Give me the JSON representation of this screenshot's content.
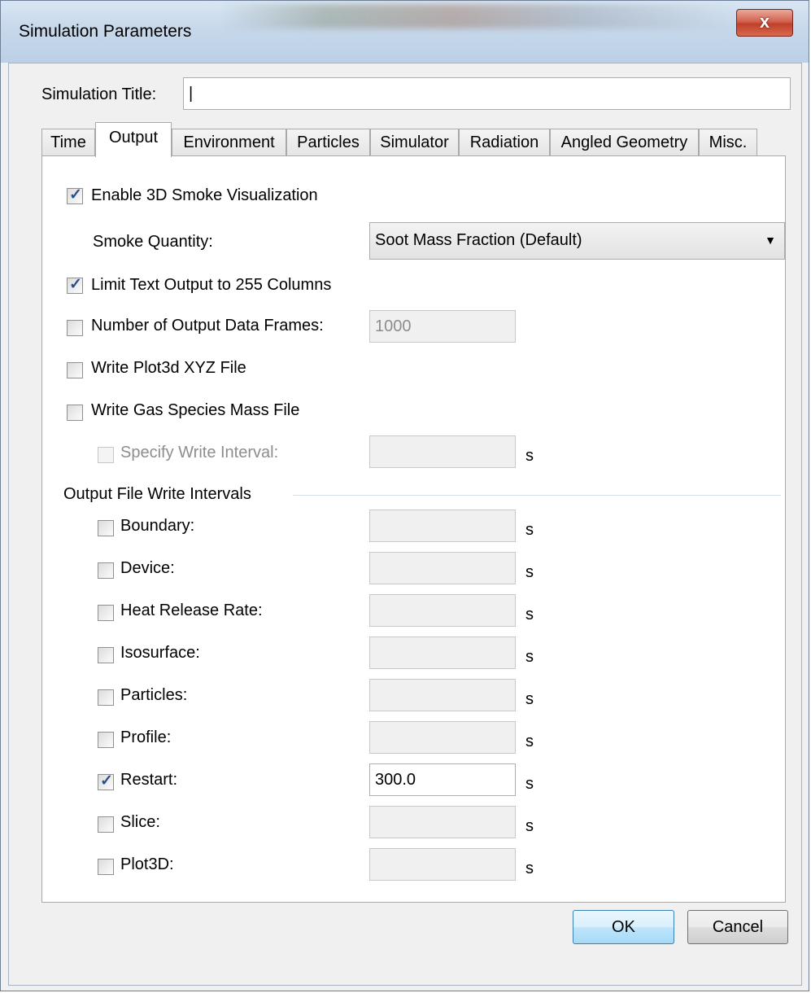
{
  "window": {
    "title": "Simulation Parameters",
    "close_glyph": "x"
  },
  "sim_title": {
    "label": "Simulation Title:",
    "value": "|"
  },
  "tabs": [
    {
      "label": "Time",
      "active": false
    },
    {
      "label": "Output",
      "active": true
    },
    {
      "label": "Environment",
      "active": false
    },
    {
      "label": "Particles",
      "active": false
    },
    {
      "label": "Simulator",
      "active": false
    },
    {
      "label": "Radiation",
      "active": false
    },
    {
      "label": "Angled Geometry",
      "active": false
    },
    {
      "label": "Misc.",
      "active": false
    }
  ],
  "output": {
    "enable_smoke": {
      "label": "Enable 3D Smoke Visualization",
      "checked": true,
      "mark": "✓"
    },
    "smoke_quantity": {
      "label": "Smoke Quantity:",
      "value": "Soot Mass Fraction (Default)",
      "arrow": "▼"
    },
    "limit_text": {
      "label": "Limit Text Output to 255 Columns",
      "checked": true,
      "mark": "✓"
    },
    "num_frames": {
      "label": "Number of Output Data Frames:",
      "checked": false,
      "value": "1000"
    },
    "write_plot3d": {
      "label": "Write Plot3d XYZ File",
      "checked": false
    },
    "write_gas": {
      "label": "Write Gas Species Mass File",
      "checked": false
    },
    "specify_interval": {
      "label": "Specify Write Interval:",
      "checked": false,
      "value": "",
      "unit": "s"
    },
    "group_label": "Output File Write Intervals",
    "intervals": [
      {
        "label": "Boundary:",
        "checked": false,
        "value": "",
        "unit": "s"
      },
      {
        "label": "Device:",
        "checked": false,
        "value": "",
        "unit": "s"
      },
      {
        "label": "Heat Release Rate:",
        "checked": false,
        "value": "",
        "unit": "s"
      },
      {
        "label": "Isosurface:",
        "checked": false,
        "value": "",
        "unit": "s"
      },
      {
        "label": "Particles:",
        "checked": false,
        "value": "",
        "unit": "s"
      },
      {
        "label": "Profile:",
        "checked": false,
        "value": "",
        "unit": "s"
      },
      {
        "label": "Restart:",
        "checked": true,
        "value": "300.0",
        "unit": "s",
        "mark": "✓"
      },
      {
        "label": "Slice:",
        "checked": false,
        "value": "",
        "unit": "s"
      },
      {
        "label": "Plot3D:",
        "checked": false,
        "value": "",
        "unit": "s"
      }
    ]
  },
  "buttons": {
    "ok": "OK",
    "cancel": "Cancel"
  }
}
